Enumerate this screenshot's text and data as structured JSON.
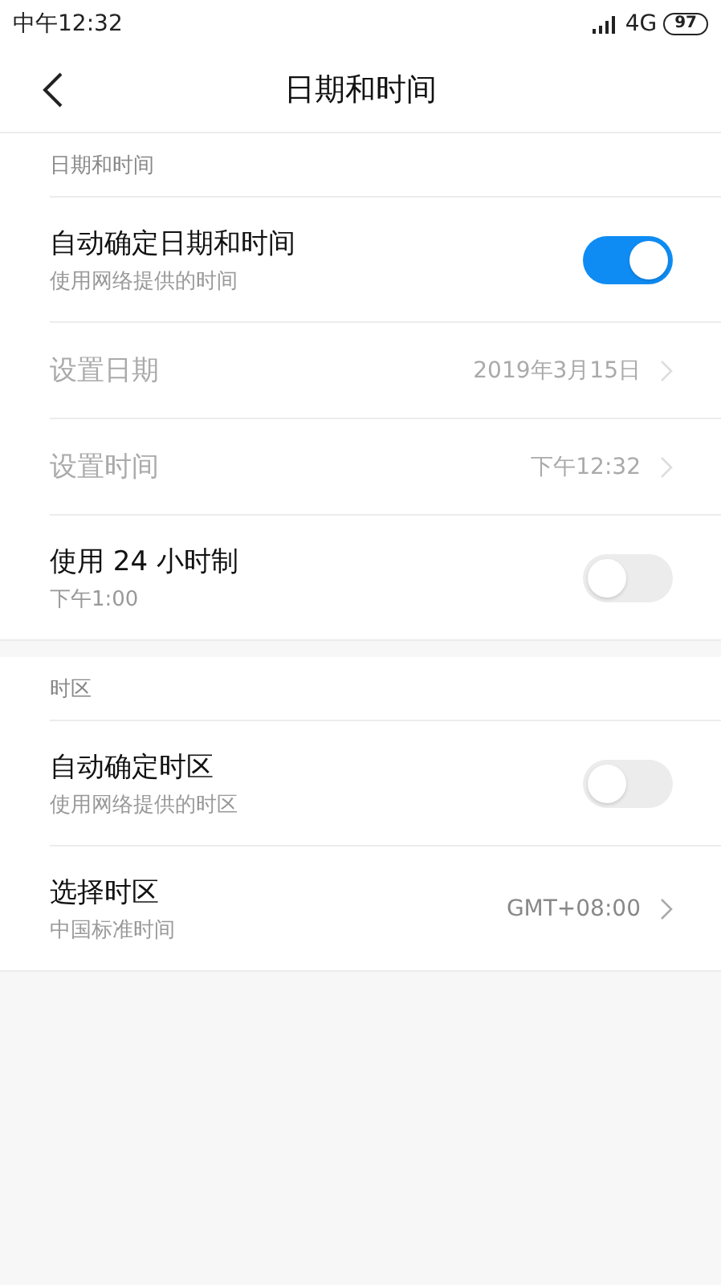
{
  "status_bar": {
    "time": "中午12:32",
    "network": "4G",
    "battery": "97"
  },
  "header": {
    "title": "日期和时间"
  },
  "sections": [
    {
      "title": "日期和时间",
      "rows": [
        {
          "kind": "toggle",
          "label": "自动确定日期和时间",
          "subtitle": "使用网络提供的时间",
          "on": true,
          "disabled": false
        },
        {
          "kind": "value",
          "label": "设置日期",
          "value": "2019年3月15日",
          "disabled": true
        },
        {
          "kind": "value",
          "label": "设置时间",
          "value": "下午12:32",
          "disabled": true
        },
        {
          "kind": "toggle",
          "label": "使用 24 小时制",
          "subtitle": "下午1:00",
          "on": false,
          "disabled": false
        }
      ]
    },
    {
      "title": "时区",
      "rows": [
        {
          "kind": "toggle",
          "label": "自动确定时区",
          "subtitle": "使用网络提供的时区",
          "on": false,
          "disabled": false
        },
        {
          "kind": "value",
          "label": "选择时区",
          "subtitle": "中国标准时间",
          "value": "GMT+08:00",
          "disabled": false
        }
      ]
    }
  ]
}
